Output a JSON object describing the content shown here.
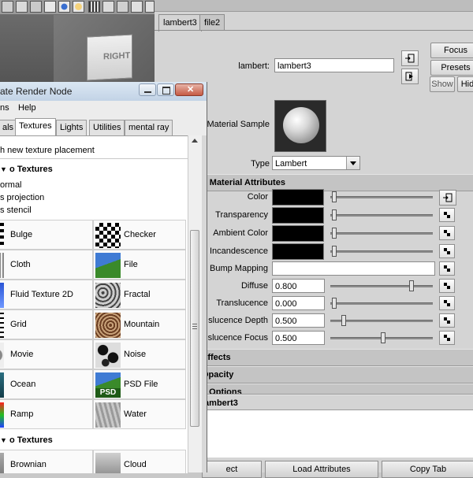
{
  "attribute_editor": {
    "tabs": [
      "lambert3",
      "file2"
    ],
    "focus_label": "Focus",
    "presets_label": "Presets",
    "show_label": "Show",
    "hide_label": "Hid",
    "node_label": "lambert:",
    "node_value": "lambert3",
    "material_sample_label": "Material Sample",
    "type_label": "Type",
    "type_value": "Lambert",
    "common_section": "n Material Attributes",
    "attributes": [
      {
        "label": "Color",
        "kind": "color",
        "value": "#000000"
      },
      {
        "label": "Transparency",
        "kind": "color",
        "value": "#000000"
      },
      {
        "label": "Ambient Color",
        "kind": "color",
        "value": "#000000"
      },
      {
        "label": "Incandescence",
        "kind": "color",
        "value": "#000000"
      },
      {
        "label": "Bump Mapping",
        "kind": "text",
        "value": ""
      },
      {
        "label": "Diffuse",
        "kind": "number",
        "value": "0.800"
      },
      {
        "label": "Translucence",
        "kind": "number",
        "value": "0.000"
      },
      {
        "label": "slucence Depth",
        "kind": "number",
        "value": "0.500"
      },
      {
        "label": "slucence Focus",
        "kind": "number",
        "value": "0.500"
      }
    ],
    "sections_collapsed": [
      "Effects",
      "Opacity",
      "e Options"
    ],
    "notes_label": "lambert3",
    "bottom_buttons": [
      "ect",
      "Load Attributes",
      "Copy Tab"
    ]
  },
  "viewport": {
    "cube_label": "RIGHT"
  },
  "create_render_node": {
    "title": "ate Render Node",
    "menu": [
      "ns",
      "Help"
    ],
    "tabs": [
      "als",
      "Textures",
      "Lights",
      "Utilities",
      "mental ray"
    ],
    "active_tab": "Textures",
    "placement_option": "h new texture placement",
    "section_2d": "o Textures",
    "options_2d": [
      "ormal",
      "s projection",
      "s stencil"
    ],
    "textures_2d": [
      "Bulge",
      "Checker",
      "Cloth",
      "File",
      "Fluid Texture 2D",
      "Fractal",
      "Grid",
      "Mountain",
      "Movie",
      "Noise",
      "Ocean",
      "PSD File",
      "Ramp",
      "Water"
    ],
    "psd_badge": "PSD",
    "section_3d": "o Textures",
    "textures_3d": [
      "Brownian",
      "Cloud"
    ]
  },
  "colors": {
    "panel_bg": "#d4d4d4",
    "title_bar": "#c2d3e6"
  }
}
